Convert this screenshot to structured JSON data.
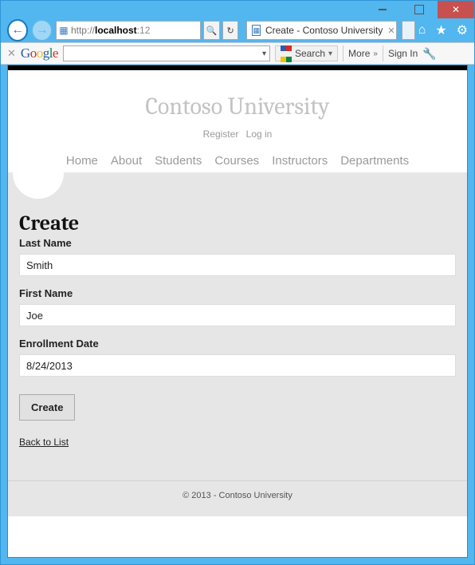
{
  "window": {
    "url_protocol": "http://",
    "url_host": "localhost",
    "url_port": ":12",
    "tab_title": "Create - Contoso University"
  },
  "gtb": {
    "logo_text": "Google",
    "search_label": "Search",
    "more_label": "More",
    "signin_label": "Sign In"
  },
  "site": {
    "title": "Contoso University",
    "auth": {
      "register": "Register",
      "login": "Log in"
    },
    "nav": [
      "Home",
      "About",
      "Students",
      "Courses",
      "Instructors",
      "Departments"
    ]
  },
  "form": {
    "heading": "Create",
    "last_name_label": "Last Name",
    "last_name_value": "Smith",
    "first_name_label": "First Name",
    "first_name_value": "Joe",
    "enroll_label": "Enrollment Date",
    "enroll_value": "8/24/2013",
    "submit_label": "Create",
    "back_label": "Back to List"
  },
  "footer": "© 2013 - Contoso University"
}
